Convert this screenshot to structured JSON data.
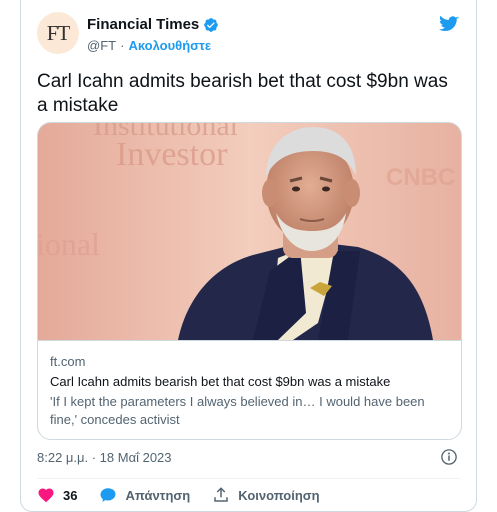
{
  "author": {
    "avatar_text": "FT",
    "name": "Financial Times",
    "handle": "@FT",
    "separator": "·",
    "follow_label": "Ακολουθήστε"
  },
  "tweet": {
    "text": "Carl Icahn admits bearish bet that cost $9bn was a mistake"
  },
  "link_card": {
    "domain": "ft.com",
    "title": "Carl Icahn admits bearish bet that cost $9bn was a mistake",
    "description": "'If I kept the parameters I always believed in… I would have been fine,' concedes activist",
    "photo_backdrop_text": [
      "Institutional",
      "Investor",
      "ional",
      "CNBC"
    ]
  },
  "meta": {
    "timestamp": "8:22 μ.μ. · 18 Μαΐ 2023"
  },
  "actions": {
    "like_count": "36",
    "reply_label": "Απάντηση",
    "share_label": "Κοινοποίηση"
  },
  "colors": {
    "accent": "#1d9bf0",
    "like": "#f91880",
    "text": "#0f1419",
    "muted": "#536471"
  }
}
